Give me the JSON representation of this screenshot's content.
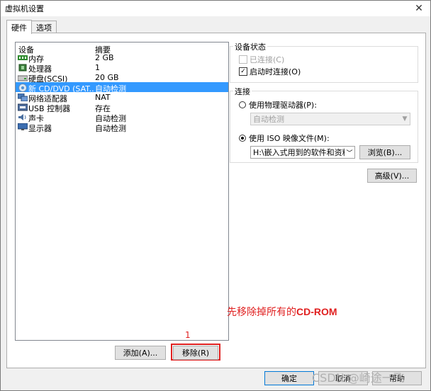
{
  "window": {
    "title": "虚拟机设置"
  },
  "tabs": [
    {
      "label": "硬件"
    },
    {
      "label": "选项"
    }
  ],
  "device_list": {
    "columns": [
      "设备",
      "摘要"
    ],
    "rows": [
      {
        "name": "内存",
        "summary": "2 GB",
        "icon": "memory-icon",
        "selected": false
      },
      {
        "name": "处理器",
        "summary": "1",
        "icon": "processor-icon",
        "selected": false
      },
      {
        "name": "硬盘(SCSI)",
        "summary": "20 GB",
        "icon": "hard-disk-icon",
        "selected": false
      },
      {
        "name": "新 CD/DVD (SAT...",
        "summary": "自动检测",
        "icon": "cd-dvd-icon",
        "selected": true
      },
      {
        "name": "网络适配器",
        "summary": "NAT",
        "icon": "network-adapter-icon",
        "selected": false
      },
      {
        "name": "USB 控制器",
        "summary": "存在",
        "icon": "usb-controller-icon",
        "selected": false
      },
      {
        "name": "声卡",
        "summary": "自动检测",
        "icon": "sound-card-icon",
        "selected": false
      },
      {
        "name": "显示器",
        "summary": "自动检测",
        "icon": "display-icon",
        "selected": false
      }
    ]
  },
  "buttons": {
    "add": "添加(A)...",
    "remove": "移除(R)",
    "advanced": "高级(V)...",
    "browse": "浏览(B)...",
    "ok": "确定",
    "cancel": "取消",
    "help": "帮助"
  },
  "device_status": {
    "label": "设备状态",
    "connected": {
      "label": "已连接(C)",
      "checked": false,
      "enabled": false
    },
    "connect_at_power_on": {
      "label": "启动时连接(O)",
      "checked": true,
      "enabled": true
    }
  },
  "connection": {
    "label": "连接",
    "physical_drive": {
      "label": "使用物理驱动器(P):",
      "selected": false
    },
    "physical_drive_value": "自动检测",
    "iso_image": {
      "label": "使用 ISO 映像文件(M):",
      "selected": true
    },
    "iso_path": "H:\\嵌入式用到的软件和资料\\"
  },
  "annotations": {
    "instruction_prefix": "先移除掉所有的",
    "instruction_bold": "CD-ROM",
    "step_number": "1"
  },
  "watermark": "CSDN @崎途一飞",
  "colors": {
    "selection": "#3399ff",
    "annotation_red": "#e02020",
    "default_button_border": "#0078d7"
  }
}
